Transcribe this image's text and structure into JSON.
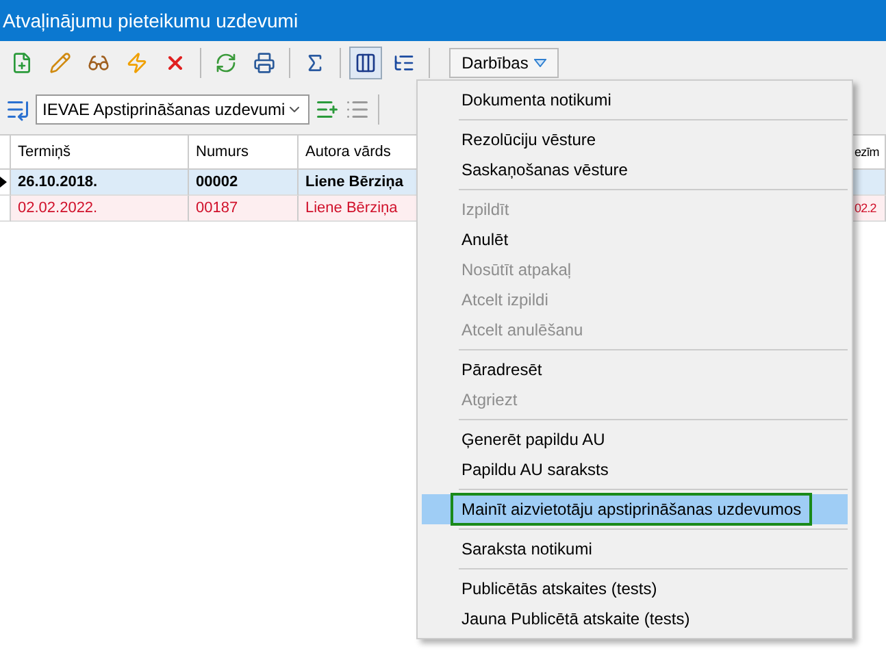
{
  "window": {
    "title": "Atvaļinājumu pieteikumu uzdevumi"
  },
  "toolbar": {
    "buttons": [
      {
        "kind": "new",
        "pressed": false
      },
      {
        "kind": "edit",
        "pressed": false
      },
      {
        "kind": "view",
        "pressed": false
      },
      {
        "kind": "flash",
        "pressed": false
      },
      {
        "kind": "delete",
        "pressed": false
      },
      {
        "kind": "separator"
      },
      {
        "kind": "refresh",
        "pressed": false
      },
      {
        "kind": "print",
        "pressed": false
      },
      {
        "kind": "separator"
      },
      {
        "kind": "sum",
        "pressed": false
      },
      {
        "kind": "separator"
      },
      {
        "kind": "columns",
        "pressed": true
      },
      {
        "kind": "tree",
        "pressed": false
      },
      {
        "kind": "separator"
      }
    ],
    "actions_button": "Darbības"
  },
  "filter": {
    "value": "IEVAE Apstiprināšanas uzdevumi"
  },
  "table": {
    "columns": [
      "Termiņš",
      "Numurs",
      "Autora vārds",
      "ezīm"
    ],
    "rows": [
      {
        "selected": true,
        "overdue": false,
        "cells": [
          "26.10.2018.",
          "00002",
          "Liene Bērziņa"
        ]
      },
      {
        "selected": false,
        "overdue": true,
        "cells": [
          "02.02.2022.",
          "00187",
          "Liene Bērziņa",
          "02.2"
        ]
      }
    ]
  },
  "menu": {
    "items": [
      {
        "kind": "item",
        "label": "Dokumenta notikumi",
        "disabled": false,
        "selected": false
      },
      {
        "kind": "separator"
      },
      {
        "kind": "item",
        "label": "Rezolūciju vēsture",
        "disabled": false,
        "selected": false
      },
      {
        "kind": "item",
        "label": "Saskaņošanas vēsture",
        "disabled": false,
        "selected": false
      },
      {
        "kind": "separator"
      },
      {
        "kind": "item",
        "label": "Izpildīt",
        "disabled": true,
        "selected": false
      },
      {
        "kind": "item",
        "label": "Anulēt",
        "disabled": false,
        "selected": false
      },
      {
        "kind": "item",
        "label": "Nosūtīt atpakaļ",
        "disabled": true,
        "selected": false
      },
      {
        "kind": "item",
        "label": "Atcelt izpildi",
        "disabled": true,
        "selected": false
      },
      {
        "kind": "item",
        "label": "Atcelt anulēšanu",
        "disabled": true,
        "selected": false
      },
      {
        "kind": "separator"
      },
      {
        "kind": "item",
        "label": "Pāradresēt",
        "disabled": false,
        "selected": false
      },
      {
        "kind": "item",
        "label": "Atgriezt",
        "disabled": true,
        "selected": false
      },
      {
        "kind": "separator"
      },
      {
        "kind": "item",
        "label": "Ģenerēt papildu AU",
        "disabled": false,
        "selected": false
      },
      {
        "kind": "item",
        "label": "Papildu AU saraksts",
        "disabled": false,
        "selected": false
      },
      {
        "kind": "separator"
      },
      {
        "kind": "item",
        "label": "Mainīt aizvietotāju apstiprināšanas uzdevumos",
        "disabled": false,
        "selected": true
      },
      {
        "kind": "separator"
      },
      {
        "kind": "item",
        "label": "Saraksta notikumi",
        "disabled": false,
        "selected": false
      },
      {
        "kind": "separator"
      },
      {
        "kind": "item",
        "label": "Publicētās atskaites (tests)",
        "disabled": false,
        "selected": false
      },
      {
        "kind": "item",
        "label": "Jauna Publicētā atskaite (tests)",
        "disabled": false,
        "selected": false
      }
    ]
  }
}
